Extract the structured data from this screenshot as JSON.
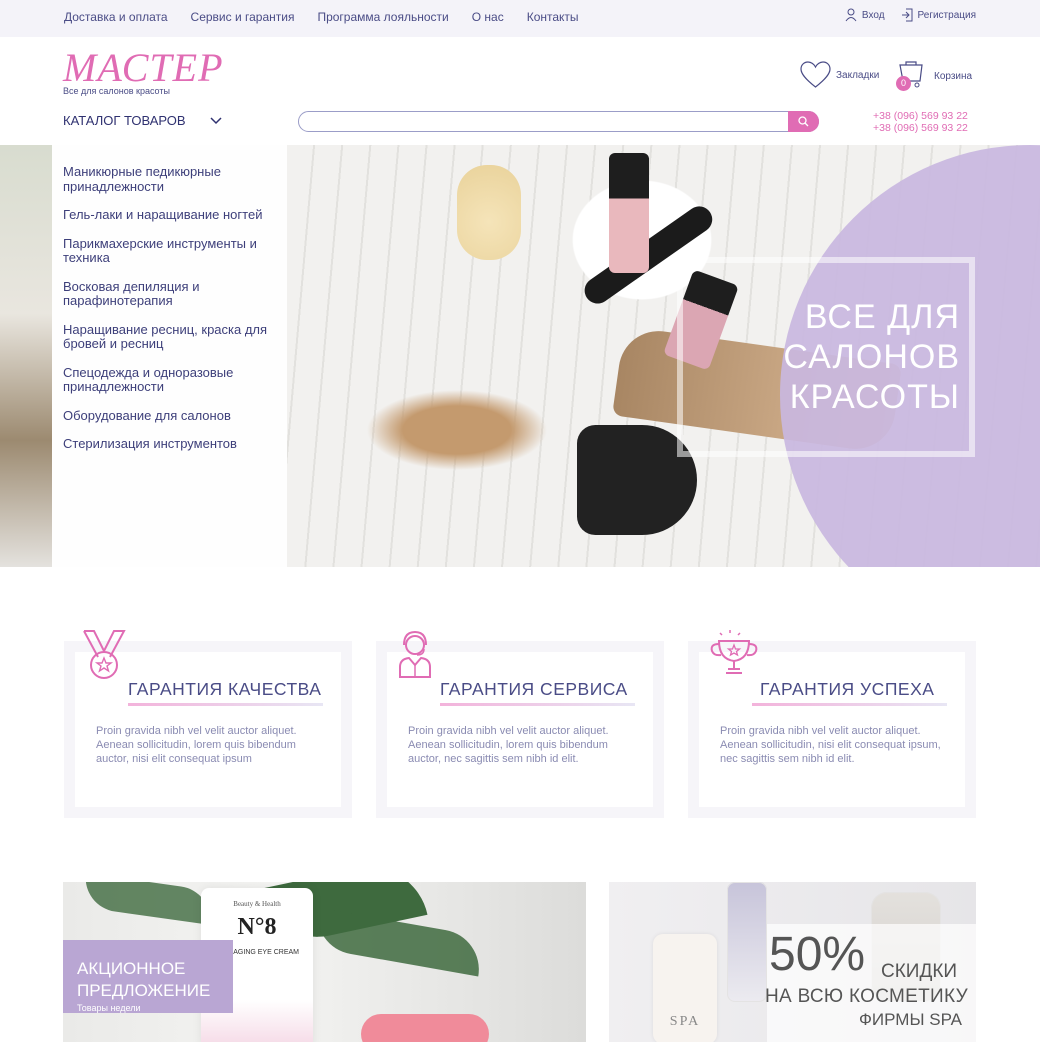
{
  "topnav": {
    "items": [
      "Доставка и оплата",
      "Сервис и гарантия",
      "Программа лояльности",
      "О нас",
      "Контакты"
    ],
    "login": "Вход",
    "register": "Регистрация"
  },
  "header": {
    "logo": "МАСТЕР",
    "logo_sub": "Все для салонов красоты",
    "favorites": "Закладки",
    "cart": "Корзина",
    "cart_count": "0",
    "catalog": "КАТАЛОГ ТОВАРОВ",
    "search_placeholder": "",
    "phones": [
      "+38 (096) 569 93 22",
      "+38 (096) 569 93 22"
    ]
  },
  "catalog_menu": [
    "Маникюрные педикюрные принадлежности",
    "Гель-лаки и наращивание ногтей",
    "Парикмахерские инструменты и техника",
    "Восковая депиляция и парафинотерапия",
    "Наращивание ресниц, краска для бровей и ресниц",
    "Спецодежда и одноразовые принадлежности",
    "Оборудование для салонов",
    "Стерилизация инструментов"
  ],
  "hero": {
    "title_lines": [
      "ВСЕ ДЛЯ",
      "САЛОНОВ",
      "КРАСОТЫ"
    ]
  },
  "features": [
    {
      "title": "ГАРАНТИЯ КАЧЕСТВА",
      "text": "Proin gravida nibh vel velit auctor aliquet. Aenean sollicitudin, lorem quis bibendum auctor, nisi elit consequat ipsum",
      "icon": "medal-icon"
    },
    {
      "title": "ГАРАНТИЯ СЕРВИСА",
      "text": "Proin gravida nibh vel velit auctor aliquet. Aenean sollicitudin, lorem quis bibendum auctor,  nec sagittis sem nibh id elit.",
      "icon": "support-agent-icon"
    },
    {
      "title": "ГАРАНТИЯ УСПЕХА",
      "text": "Proin gravida nibh vel velit auctor aliquet. Aenean sollicitudin, nisi elit consequat ipsum, nec sagittis sem nibh id elit.",
      "icon": "trophy-icon"
    }
  ],
  "promo1": {
    "label_line1": "АКЦИОННОЕ",
    "label_line2": "ПРЕДЛОЖЕНИЕ",
    "label_sub": "Товары недели",
    "tube_brand": "Beauty & Health",
    "tube_number": "N°8",
    "tube_text": "ANTI-AGING EYE CREAM"
  },
  "promo2": {
    "percent": "50%",
    "percent_suffix": "СКИДКИ",
    "line2": "НА ВСЮ КОСМЕТИКУ",
    "line3": "ФИРМЫ SPA",
    "product_label": "SPA"
  },
  "colors": {
    "accent_pink": "#e06cb4",
    "text_navy": "#3d3f7a",
    "lavender": "#c9b7df"
  }
}
